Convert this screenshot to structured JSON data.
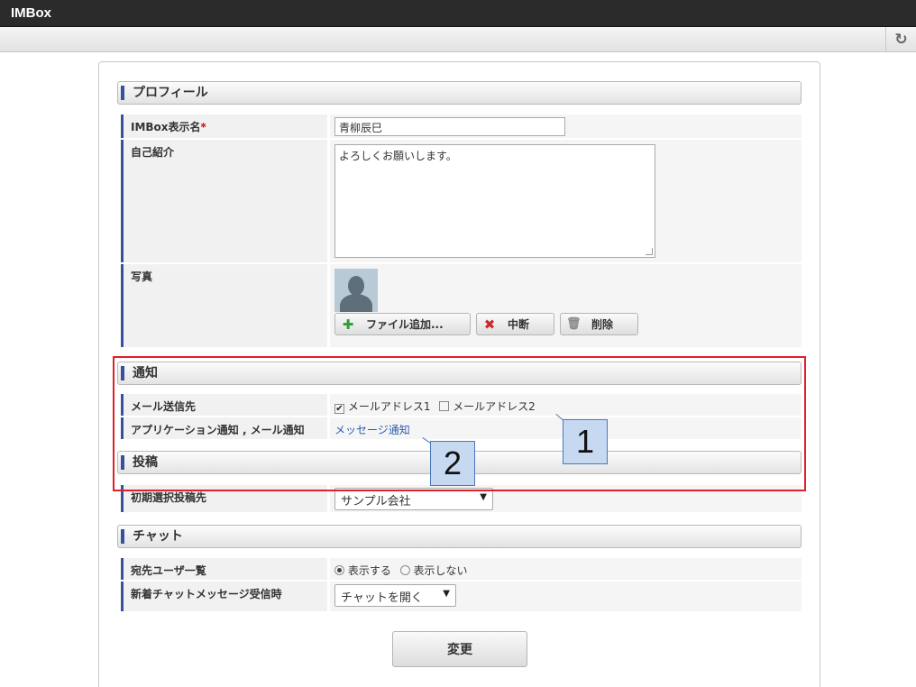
{
  "app": {
    "title": "IMBox"
  },
  "toolbar": {
    "refresh_icon": "refresh-icon"
  },
  "sections": {
    "profile": "プロフィール",
    "notification": "通知",
    "posting": "投稿",
    "chat": "チャット"
  },
  "profile": {
    "display_name_label": "IMBox表示名",
    "required_mark": "*",
    "display_name_value": "青柳辰巳",
    "intro_label": "自己紹介",
    "intro_value": "よろしくお願いします。",
    "photo_label": "写真",
    "add_file_button": "ファイル追加...",
    "cancel_button": "中断",
    "delete_button": "削除"
  },
  "notification": {
    "mail_label": "メール送信先",
    "mail_option1": "メールアドレス1",
    "mail_option1_checked": true,
    "mail_option2": "メールアドレス2",
    "mail_option2_checked": false,
    "app_notify_label": "アプリケーション通知 , メール通知",
    "app_notify_link": "メッセージ通知"
  },
  "posting": {
    "default_target_label": "初期選択投稿先",
    "default_target_value": "サンプル会社"
  },
  "chat": {
    "recipient_list_label": "宛先ユーザ一覧",
    "show_option": "表示する",
    "hide_option": "表示しない",
    "selected": "show",
    "new_message_label": "新着チャットメッセージ受信時",
    "new_message_value": "チャットを開く"
  },
  "submit_button": "変更",
  "callouts": [
    "1",
    "2"
  ],
  "colors": {
    "accent": "#35529a",
    "highlight": "#e0202a",
    "callout_fill": "#c6d9f1"
  }
}
